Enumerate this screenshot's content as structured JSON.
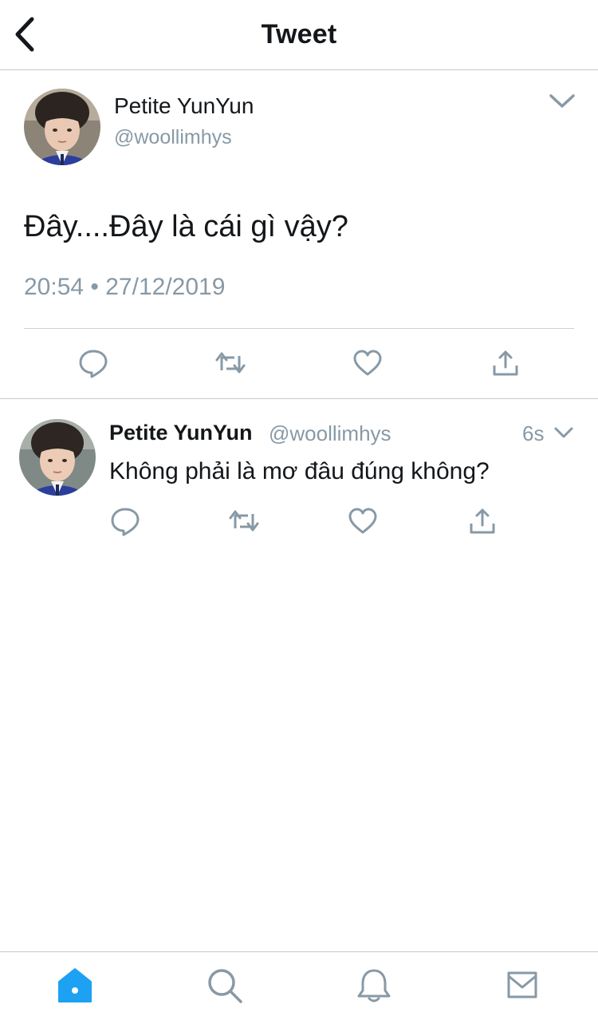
{
  "header": {
    "title": "Tweet"
  },
  "tweet": {
    "author_name": "Petite YunYun",
    "author_handle": "@woollimhys",
    "text": "Đây....Đây là cái gì vậy?",
    "timestamp": "20:54 • 27/12/2019"
  },
  "reply": {
    "author_name": "Petite YunYun",
    "author_handle": "@woollimhys",
    "time_ago": "6s",
    "text": "Không phải là mơ đâu đúng không?"
  },
  "colors": {
    "text_primary": "#14171a",
    "text_secondary": "#8899a6",
    "icon_gray": "#8899a6",
    "accent_blue": "#1da1f2"
  },
  "icons": {
    "header": [
      "back-arrow-icon",
      "chevron-down-icon"
    ],
    "actions": [
      "reply-icon",
      "retweet-icon",
      "like-icon",
      "share-icon"
    ],
    "tabs": [
      "home-icon",
      "search-icon",
      "notifications-icon",
      "messages-icon"
    ]
  },
  "tabbar": {
    "active_tab": "home"
  }
}
